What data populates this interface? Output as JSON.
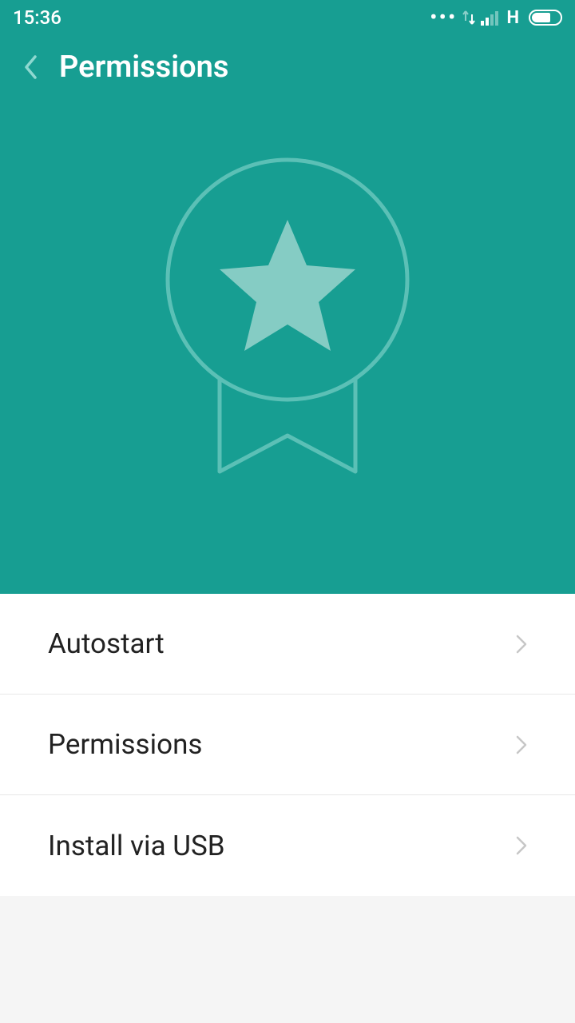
{
  "status": {
    "time": "15:36",
    "network_label": "H"
  },
  "navbar": {
    "title": "Permissions"
  },
  "list": {
    "items": [
      {
        "label": "Autostart"
      },
      {
        "label": "Permissions"
      },
      {
        "label": "Install via USB"
      }
    ]
  }
}
